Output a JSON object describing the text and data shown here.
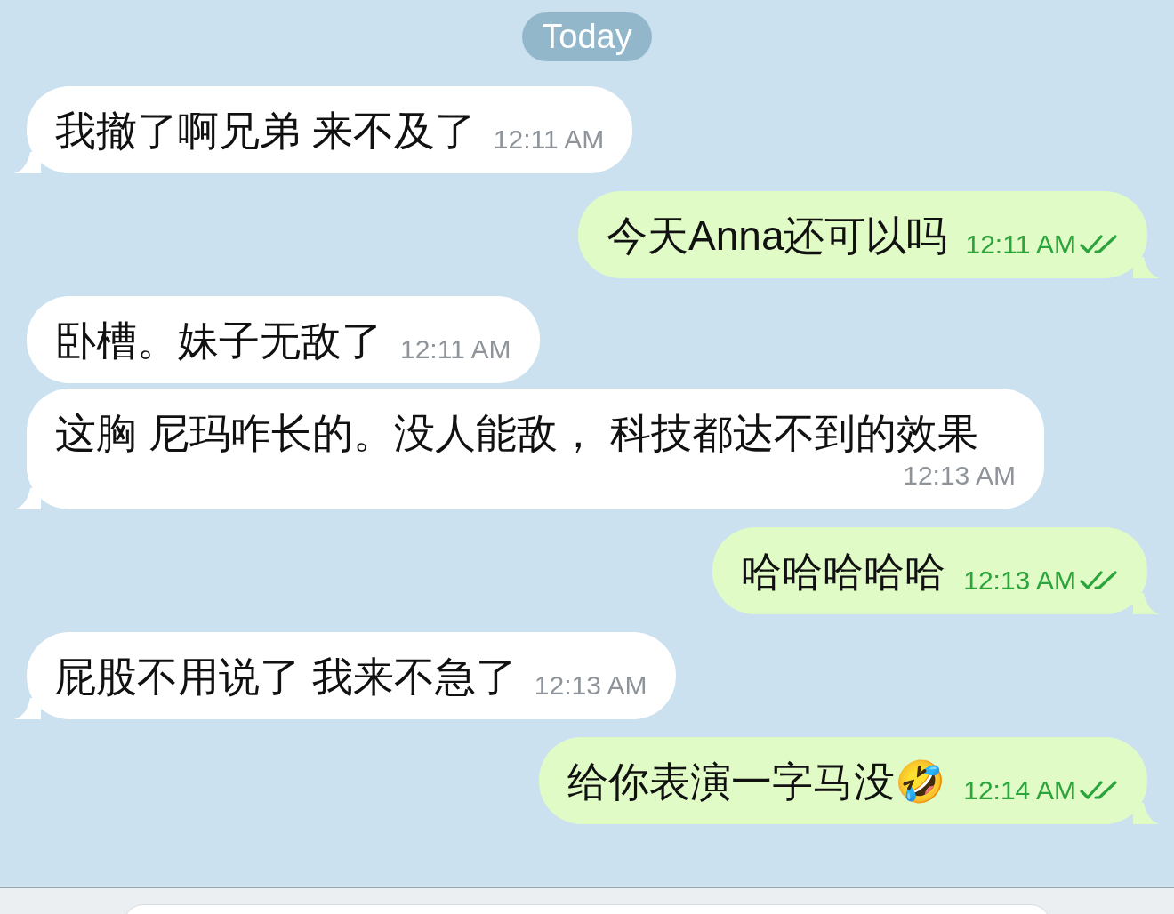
{
  "date_label": "Today",
  "messages": [
    {
      "kind": "incoming",
      "text": "我撤了啊兄弟 来不及了",
      "time": "12:11 AM",
      "read": false
    },
    {
      "kind": "outgoing",
      "text": "今天Anna还可以吗",
      "time": "12:11 AM",
      "read": true
    },
    {
      "kind": "incoming",
      "text": "卧槽。妹子无敌了",
      "time": "12:11 AM",
      "read": false
    },
    {
      "kind": "incoming",
      "text": "这胸 尼玛咋长的。没人能敌， 科技都达不到的效果",
      "time": "12:13 AM",
      "read": false
    },
    {
      "kind": "outgoing",
      "text": "哈哈哈哈哈",
      "time": "12:13 AM",
      "read": true
    },
    {
      "kind": "incoming",
      "text": "屁股不用说了 我来不急了",
      "time": "12:13 AM",
      "read": false
    },
    {
      "kind": "outgoing",
      "text": "给你表演一字马没🤣",
      "time": "12:14 AM",
      "read": true
    }
  ]
}
